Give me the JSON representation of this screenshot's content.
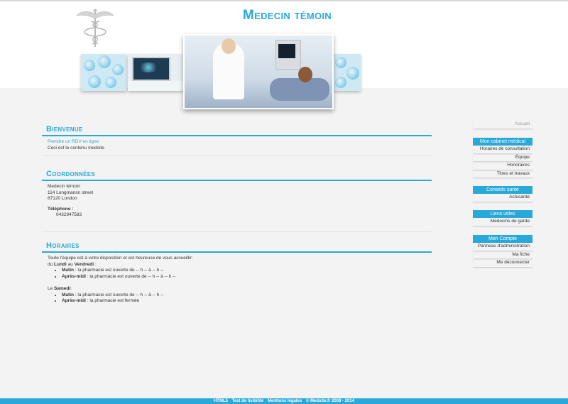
{
  "site": {
    "title": "Medecin témoin"
  },
  "sidebar": {
    "home": "Accueil",
    "groups": [
      {
        "title": "Mon cabinet médical",
        "items": [
          "Horaires de consultation",
          "Équipe",
          "Honoraires",
          "Titres et travaux"
        ]
      },
      {
        "title": "Conseils santé",
        "items": [
          "Actusanté"
        ]
      },
      {
        "title": "Liens utiles",
        "items": [
          "Médecins de garde"
        ]
      },
      {
        "title": "Mon Compte",
        "items": [
          "Panneau d'administration",
          "Ma fiche",
          "Me déconnecter"
        ]
      }
    ]
  },
  "bienvenue": {
    "title": "Bienvenue",
    "rdv_link": "Prendre un RDV en ligne",
    "text": "Ceci est le contenu medsite"
  },
  "coordonnees": {
    "title": "Coordonnées",
    "name": "Medecin témoin",
    "street": "114 Longmansn street",
    "city": "87120 London",
    "phone_label": "Téléphone :",
    "phone": "0432947583"
  },
  "horaires": {
    "title": "Horaires",
    "intro": "Toute l'équipe est à votre disposition et est heureuse de vous accueillir:",
    "weekday_prefix": "du",
    "weekday_start": "Lundi",
    "weekday_mid": "au",
    "weekday_end": "Vendredi",
    "weekday_suffix": ":",
    "weekday_items": [
      {
        "label": "Matin",
        "text": " : la pharmacie est ouverte de -- h -- à -- h --"
      },
      {
        "label": "Après-midi",
        "text": " : la pharmacie est ouverte de -- h -- à -- h --"
      }
    ],
    "saturday_prefix": "Le",
    "saturday": "Samedi",
    "saturday_suffix": ":",
    "saturday_items": [
      {
        "label": "Matin",
        "text": " : la pharmacie est ouverte de -- h -- à -- h --"
      },
      {
        "label": "Après-midi",
        "text": " : la pharmacie est fermée"
      }
    ]
  },
  "footer": {
    "links": [
      "HTML5",
      "Test de lisibilité",
      "Mentions légales"
    ],
    "copyright": "© Medsite.fr 2008 - 2014"
  },
  "colors": {
    "accent": "#29a9d9",
    "background": "#f3f3f3"
  }
}
